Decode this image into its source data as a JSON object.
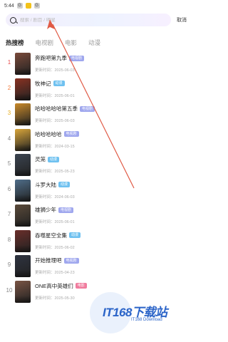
{
  "status_bar": {
    "time": "5:44",
    "icons": [
      "G",
      "",
      "G"
    ]
  },
  "search": {
    "placeholder": "搜索 / 剧目 / 明星",
    "cancel_label": "取消"
  },
  "tabs": [
    {
      "label": "热搜榜",
      "active": true
    },
    {
      "label": "电视剧",
      "active": false
    },
    {
      "label": "电影",
      "active": false
    },
    {
      "label": "动漫",
      "active": false
    }
  ],
  "ranking": [
    {
      "rank": "1",
      "title": "奔跑吧第九季",
      "tag": "电视剧",
      "updated": "更新时间：2025-06-03",
      "color": "#7a4a3a"
    },
    {
      "rank": "2",
      "title": "牧神记",
      "tag": "动漫",
      "updated": "更新时间：2025-06-01",
      "color": "#8a3222"
    },
    {
      "rank": "3",
      "title": "哈哈哈哈哈第五季",
      "tag": "电视剧",
      "updated": "更新时间：2025-06-03",
      "color": "#c98a2a"
    },
    {
      "rank": "4",
      "title": "哈哈哈哈哈",
      "tag": "电视剧",
      "updated": "更新时间：2024-03-15",
      "color": "#d9a63a"
    },
    {
      "rank": "5",
      "title": "灵笼",
      "tag": "动漫",
      "updated": "更新时间：2025-05-23",
      "color": "#3b4450"
    },
    {
      "rank": "6",
      "title": "斗罗大陆",
      "tag": "动漫",
      "updated": "更新时间：2024-06-03",
      "color": "#4f6e8a"
    },
    {
      "rank": "7",
      "title": "雄狮少年",
      "tag": "电视剧",
      "updated": "更新时间：2025-06-01",
      "color": "#5a4a3a"
    },
    {
      "rank": "8",
      "title": "吞噬星空全集",
      "tag": "动漫",
      "updated": "更新时间：2025-06-02",
      "color": "#6a2e2a"
    },
    {
      "rank": "9",
      "title": "开始推理吧",
      "tag": "电视剧",
      "updated": "更新时间：2025-04-23",
      "color": "#2e3340"
    },
    {
      "rank": "10",
      "title": "ONE高中英雄们",
      "tag": "电影",
      "updated": "更新时间：2025-05-30",
      "color": "#7a5444"
    }
  ],
  "watermark": {
    "brand": "IT168下载站",
    "sub": "IT168 Download"
  },
  "annotation_color": "#e05a45"
}
